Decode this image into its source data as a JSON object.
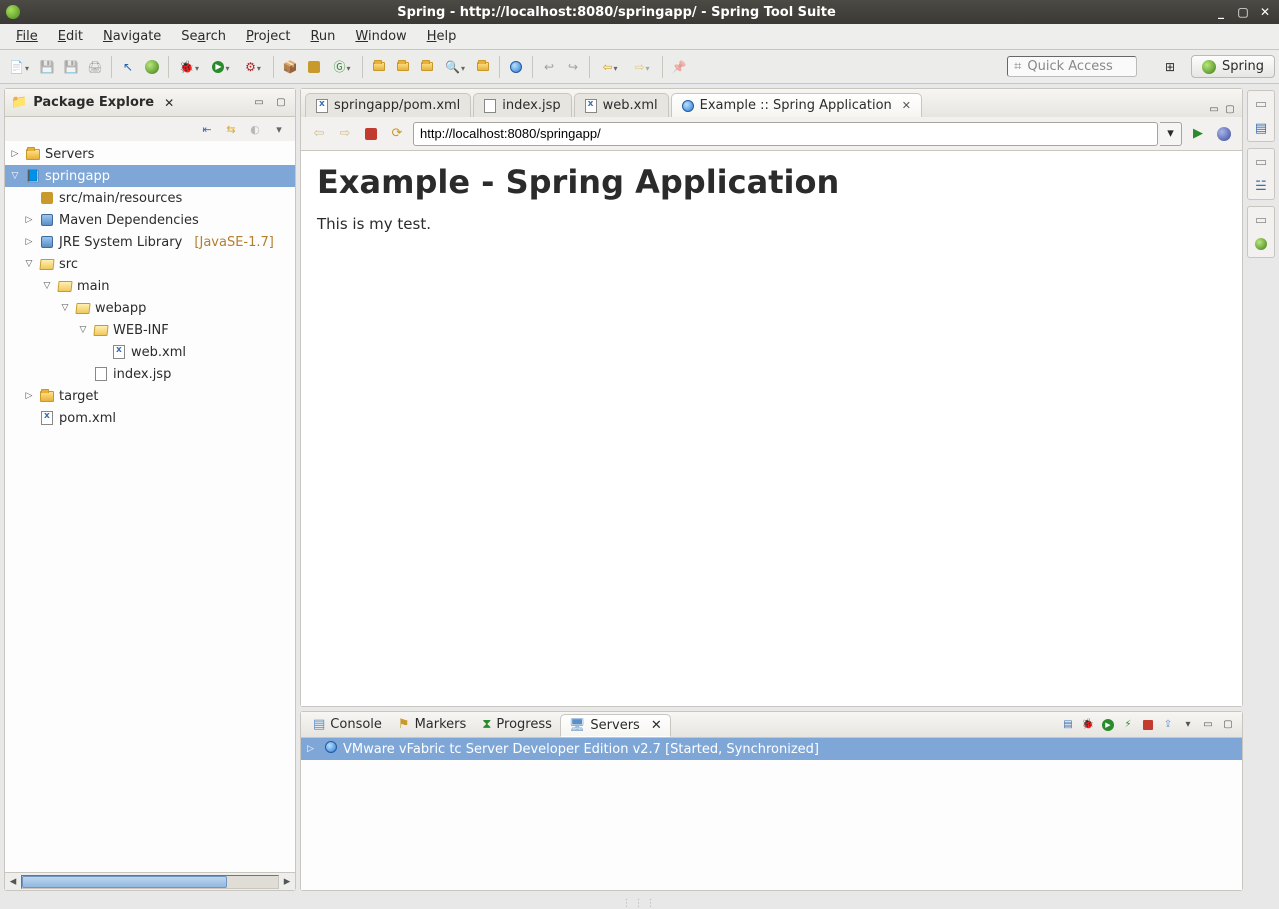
{
  "window": {
    "title": "Spring - http://localhost:8080/springapp/ - Spring Tool Suite"
  },
  "menu": [
    "File",
    "Edit",
    "Navigate",
    "Search",
    "Project",
    "Run",
    "Window",
    "Help"
  ],
  "toolbar": {
    "quick_access_placeholder": "Quick Access",
    "perspective_label": "Spring"
  },
  "package_explorer": {
    "title": "Package Explore",
    "tree": {
      "servers": "Servers",
      "springapp": "springapp",
      "resources": "src/main/resources",
      "maven_deps": "Maven Dependencies",
      "jre": "JRE System Library",
      "jre_decor": "[JavaSE-1.7]",
      "src": "src",
      "main": "main",
      "webapp": "webapp",
      "webinf": "WEB-INF",
      "webxml": "web.xml",
      "indexjsp": "index.jsp",
      "target": "target",
      "pomxml": "pom.xml"
    }
  },
  "editor": {
    "tabs": [
      {
        "label": "springapp/pom.xml",
        "icon": "xml"
      },
      {
        "label": "index.jsp",
        "icon": "jsp"
      },
      {
        "label": "web.xml",
        "icon": "xml"
      },
      {
        "label": "Example :: Spring Application",
        "icon": "globe",
        "active": true
      }
    ],
    "url": "http://localhost:8080/springapp/",
    "page_heading": "Example - Spring Application",
    "page_body": "This is my test."
  },
  "bottom": {
    "tabs": [
      "Console",
      "Markers",
      "Progress",
      "Servers"
    ],
    "active_tab": "Servers",
    "server_row": "VMware vFabric tc Server Developer Edition v2.7  [Started, Synchronized]"
  }
}
